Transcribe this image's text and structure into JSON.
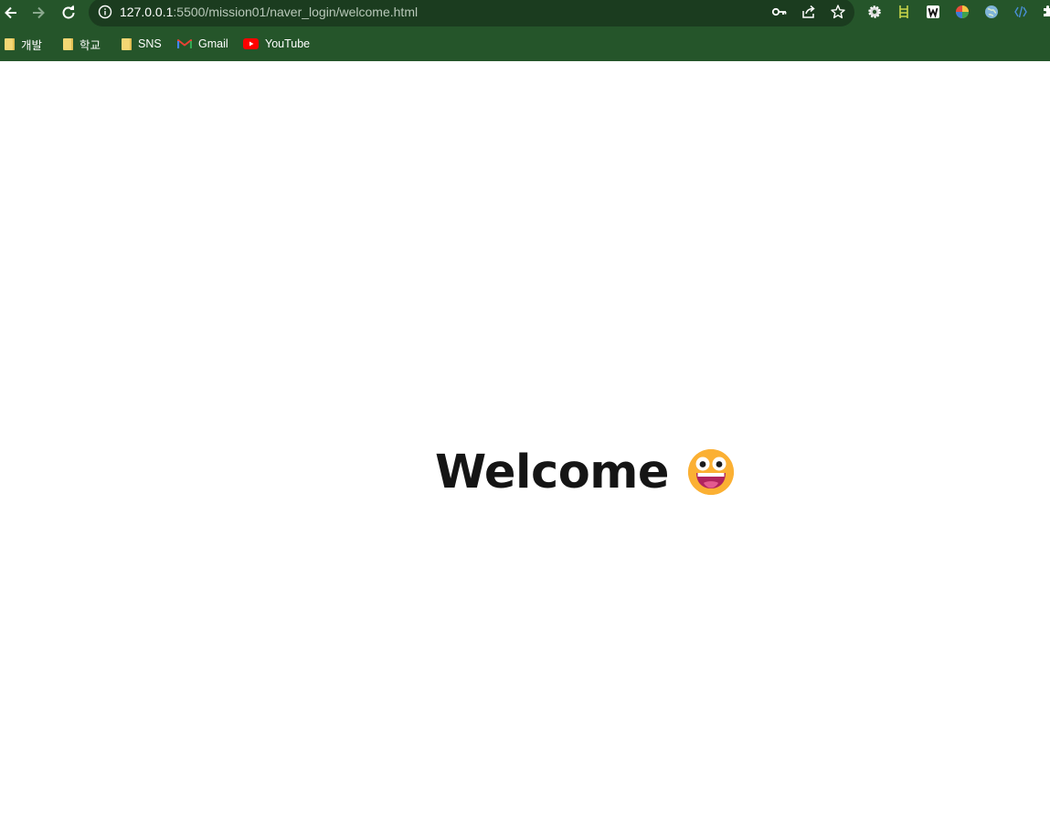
{
  "browser": {
    "url_host": "127.0.0.1",
    "url_rest": ":5500/mission01/naver_login/welcome.html",
    "back_icon": "arrow-left-icon",
    "forward_icon": "arrow-right-icon",
    "reload_icon": "reload-icon",
    "site_info_icon": "info-icon",
    "omnibox_icons": [
      "key-icon",
      "share-icon",
      "star-icon"
    ],
    "extensions": [
      "gear-extension-icon",
      "ladder-extension-icon",
      "w-extension-icon",
      "color-wheel-extension-icon",
      "globe-extension-icon",
      "code-extension-icon",
      "puzzle-icon"
    ],
    "colors": {
      "frame": "#25552a",
      "omnibox": "#1b3c1f"
    }
  },
  "bookmarks": [
    {
      "label": "개발",
      "icon": "folder-icon"
    },
    {
      "label": "학교",
      "icon": "folder-icon"
    },
    {
      "label": "SNS",
      "icon": "folder-icon"
    },
    {
      "label": "Gmail",
      "icon": "gmail-icon"
    },
    {
      "label": "YouTube",
      "icon": "youtube-icon"
    }
  ],
  "page": {
    "heading": "Welcome",
    "emoji": "grinning-face-icon"
  }
}
